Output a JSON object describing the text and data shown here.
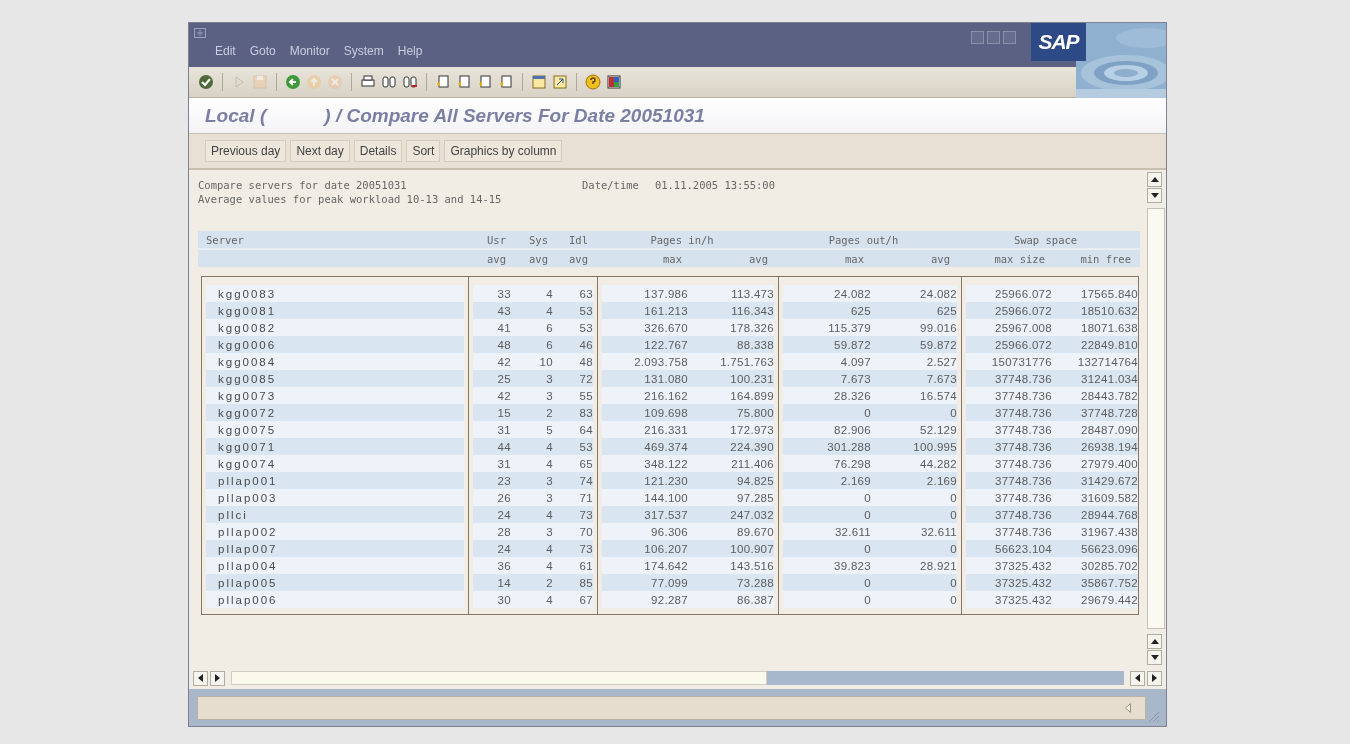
{
  "window": {
    "logo": "SAP"
  },
  "menu": [
    "Edit",
    "Goto",
    "Monitor",
    "System",
    "Help"
  ],
  "toolbar": [
    {
      "kind": "check",
      "disabled": false
    },
    {
      "kind": "sep"
    },
    {
      "kind": "play",
      "disabled": true
    },
    {
      "kind": "save",
      "disabled": true
    },
    {
      "kind": "sep"
    },
    {
      "kind": "back",
      "disabled": false
    },
    {
      "kind": "exit",
      "disabled": true
    },
    {
      "kind": "cancel",
      "disabled": true
    },
    {
      "kind": "sep"
    },
    {
      "kind": "print",
      "disabled": false
    },
    {
      "kind": "find",
      "disabled": false
    },
    {
      "kind": "findnext",
      "disabled": false
    },
    {
      "kind": "sep"
    },
    {
      "kind": "page",
      "disabled": false
    },
    {
      "kind": "page",
      "disabled": false
    },
    {
      "kind": "page",
      "disabled": false
    },
    {
      "kind": "page",
      "disabled": false
    },
    {
      "kind": "sep"
    },
    {
      "kind": "session",
      "disabled": false
    },
    {
      "kind": "shortcut",
      "disabled": false
    },
    {
      "kind": "sep"
    },
    {
      "kind": "help",
      "disabled": false
    },
    {
      "kind": "layout",
      "disabled": false
    }
  ],
  "title": "Local (           ) / Compare All Servers For Date 20051031",
  "buttons": [
    "Previous day",
    "Next day",
    "Details",
    "Sort",
    "Graphics by column"
  ],
  "report": {
    "line_1": "Compare servers for date 20051031",
    "datetime_label": "Date/time",
    "datetime": "01.11.2005 13:55:00",
    "line_2": "Average values for peak workload 10-13 and 14-15"
  },
  "table": {
    "header_1": [
      "Server",
      "Usr",
      "Sys",
      "Idl",
      "Pages in/h",
      "Pages out/h",
      "Swap space"
    ],
    "header_2": [
      "avg",
      "avg",
      "avg",
      "max",
      "avg",
      "max",
      "avg",
      "max size",
      "min free"
    ],
    "rows": [
      [
        "kgg0083",
        "33",
        "4",
        "63",
        "137.986",
        "113.473",
        "24.082",
        "24.082",
        "25966.072",
        "17565.840"
      ],
      [
        "kgg0081",
        "43",
        "4",
        "53",
        "161.213",
        "116.343",
        "625",
        "625",
        "25966.072",
        "18510.632"
      ],
      [
        "kgg0082",
        "41",
        "6",
        "53",
        "326.670",
        "178.326",
        "115.379",
        "99.016",
        "25967.008",
        "18071.638"
      ],
      [
        "kgg0006",
        "48",
        "6",
        "46",
        "122.767",
        "88.338",
        "59.872",
        "59.872",
        "25966.072",
        "22849.810"
      ],
      [
        "kgg0084",
        "42",
        "10",
        "48",
        "2.093.758",
        "1.751.763",
        "4.097",
        "2.527",
        "150731776",
        "132714764"
      ],
      [
        "kgg0085",
        "25",
        "3",
        "72",
        "131.080",
        "100.231",
        "7.673",
        "7.673",
        "37748.736",
        "31241.034"
      ],
      [
        "kgg0073",
        "42",
        "3",
        "55",
        "216.162",
        "164.899",
        "28.326",
        "16.574",
        "37748.736",
        "28443.782"
      ],
      [
        "kgg0072",
        "15",
        "2",
        "83",
        "109.698",
        "75.800",
        "0",
        "0",
        "37748.736",
        "37748.728"
      ],
      [
        "kgg0075",
        "31",
        "5",
        "64",
        "216.331",
        "172.973",
        "82.906",
        "52.129",
        "37748.736",
        "28487.090"
      ],
      [
        "kgg0071",
        "44",
        "4",
        "53",
        "469.374",
        "224.390",
        "301.288",
        "100.995",
        "37748.736",
        "26938.194"
      ],
      [
        "kgg0074",
        "31",
        "4",
        "65",
        "348.122",
        "211.406",
        "76.298",
        "44.282",
        "37748.736",
        "27979.400"
      ],
      [
        "pllap001",
        "23",
        "3",
        "74",
        "121.230",
        "94.825",
        "2.169",
        "2.169",
        "37748.736",
        "31429.672"
      ],
      [
        "pllap003",
        "26",
        "3",
        "71",
        "144.100",
        "97.285",
        "0",
        "0",
        "37748.736",
        "31609.582"
      ],
      [
        "pllci",
        "24",
        "4",
        "73",
        "317.537",
        "247.032",
        "0",
        "0",
        "37748.736",
        "28944.768"
      ],
      [
        "pllap002",
        "28",
        "3",
        "70",
        "96.306",
        "89.670",
        "32.611",
        "32.611",
        "37748.736",
        "31967.438"
      ],
      [
        "pllap007",
        "24",
        "4",
        "73",
        "106.207",
        "100.907",
        "0",
        "0",
        "56623.104",
        "56623.096"
      ],
      [
        "pllap004",
        "36",
        "4",
        "61",
        "174.642",
        "143.516",
        "39.823",
        "28.921",
        "37325.432",
        "30285.702"
      ],
      [
        "pllap005",
        "14",
        "2",
        "85",
        "77.099",
        "73.288",
        "0",
        "0",
        "37325.432",
        "35867.752"
      ],
      [
        "pllap006",
        "30",
        "4",
        "67",
        "92.287",
        "86.387",
        "0",
        "0",
        "37325.432",
        "29679.442"
      ]
    ]
  }
}
